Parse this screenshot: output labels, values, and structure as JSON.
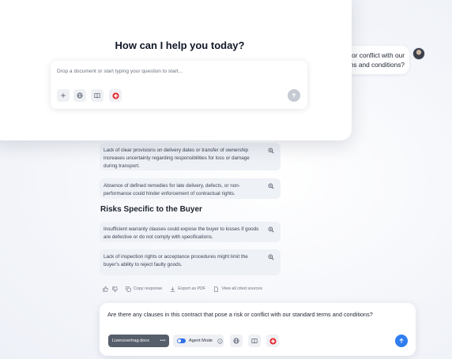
{
  "background_thread": {
    "user_message": "t or conflict with our\nterms and conditions?",
    "cards": [
      {
        "text": "Lack of clear provisions on delivery dates or transfer of ownership increases uncertainty regarding responsibilities for loss or damage during transport."
      },
      {
        "text": "Absence of defined remedies for late delivery, defects, or non-performance could hinder enforcement of contractual rights."
      },
      {
        "text": "Insufficient warranty clauses could expose the buyer to losses if goods are defective or do not comply with specifications."
      },
      {
        "text": "Lack of inspection rights or acceptance procedures might limit the buyer's ability to reject faulty goods."
      }
    ],
    "section_title": "Risks Specific to the Buyer",
    "actions": {
      "copy": "Copy response",
      "export": "Export as PDF",
      "sources": "View all cited sources"
    }
  },
  "composer": {
    "text": "Are there any clauses in this contract that pose a risk or conflict with our standard terms and conditions?",
    "file_name": "Lizenzvertrag.docx",
    "file_more": "•••",
    "agent_mode_label": "Agent Mode"
  },
  "modal": {
    "title": "How can I help you today?",
    "placeholder": "Drop a document or start typing your question to start..."
  },
  "colors": {
    "accent_blue": "#2f7ef0",
    "toggle_blue": "#2f6fe8",
    "danger_red": "#e5262b",
    "file_chip": "#565d6b"
  }
}
